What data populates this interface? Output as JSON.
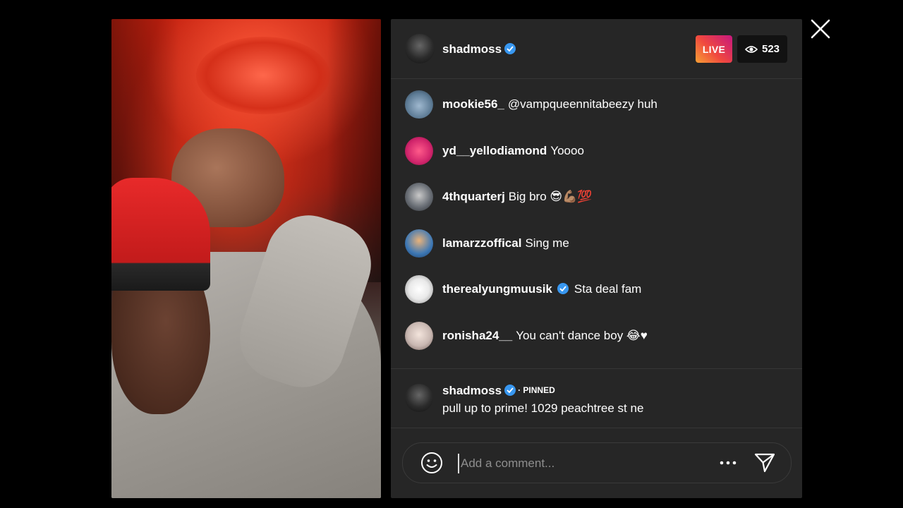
{
  "stream": {
    "host_username": "shadmoss",
    "live_label": "LIVE",
    "viewer_count": "523"
  },
  "comments": [
    {
      "username": "mookie56_",
      "message": "@vampqueennitabeezy huh",
      "avatar_color": "#6a8fb0"
    },
    {
      "username": "yd__yellodiamond",
      "message": "Yoooo",
      "avatar_color": "#d0246b"
    },
    {
      "username": "4thquarterj",
      "message": "Big bro 😎💪🏽💯",
      "avatar_color": "#5a5f66"
    },
    {
      "username": "lamarzzoffical",
      "message": "Sing me",
      "avatar_color": "#3d78b5"
    },
    {
      "username": "therealyungmuusik",
      "message": "Sta deal fam",
      "avatar_color": "#e9e9e9",
      "verified": true
    },
    {
      "username": "ronisha24__",
      "message": "You can't dance boy 😂♥",
      "avatar_color": "#c9b8b2"
    }
  ],
  "pinned": {
    "username": "shadmoss",
    "tag": "· PINNED",
    "message": "pull up to prime! 1029 peachtree st ne"
  },
  "composer": {
    "placeholder": "Add a comment..."
  },
  "icons": {
    "close": "close-icon",
    "eye": "eye-icon",
    "emoji": "emoji-icon",
    "more": "more-icon",
    "send": "send-icon",
    "verified": "verified-badge-icon"
  }
}
